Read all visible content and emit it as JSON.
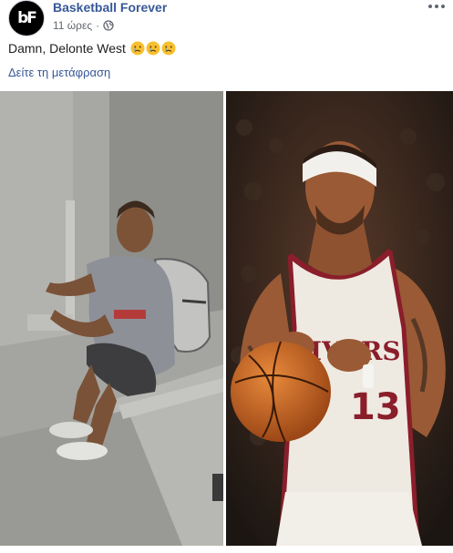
{
  "post": {
    "page_name": "Basketball Forever",
    "avatar_text": "bF",
    "timestamp": "11 ώρες",
    "separator": "·",
    "privacy_icon": "globe-icon",
    "more_icon": "more-options-icon",
    "text": "Damn, Delonte West",
    "emojis": [
      "sad-face-emoji",
      "sad-face-emoji",
      "sad-face-emoji"
    ],
    "see_translation": "Δείτε τη μετάφραση"
  },
  "photos": [
    {
      "name": "photo-street"
    },
    {
      "name": "photo-basketball-player",
      "jersey_text": "IVERS",
      "jersey_number": "13"
    }
  ],
  "colors": {
    "link": "#385898",
    "secondary_text": "#616770",
    "primary_text": "#1c1e21"
  }
}
